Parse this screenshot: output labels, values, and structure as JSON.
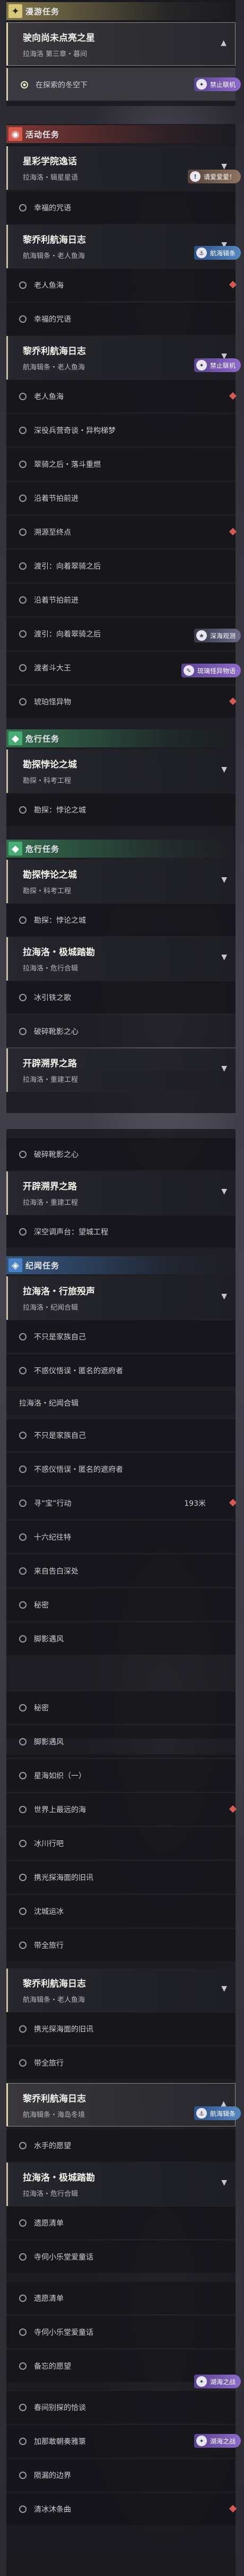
{
  "colors": {
    "main_accent": "#d8c77a",
    "event_accent": "#d85a4e",
    "daily_accent": "#47ad74",
    "discovery_accent": "#4a82c6",
    "marker_red": "#d25a52"
  },
  "sections": {
    "main": {
      "label": "漫游任务",
      "mark": "✦"
    },
    "event": {
      "label": "活动任务",
      "mark": "◉"
    },
    "daily1": {
      "label": "危行任务",
      "mark": "◆"
    },
    "daily2": {
      "label": "危行任务",
      "mark": "◆"
    },
    "discovery": {
      "label": "纪闻任务",
      "mark": "◈"
    }
  },
  "quests": [
    {
      "title": "驶向尚未点亮之星",
      "subtitle": "拉海洛 第三章・暮间"
    },
    {
      "title": "星彩学院逸话",
      "subtitle": "拉海洛・辑星星语"
    },
    {
      "title": "黎乔利航海日志",
      "subtitle": "航海辑条・老人鱼海"
    },
    {
      "title": "黎乔利航海日志",
      "subtitle": "航海辑条・老人鱼海"
    },
    {
      "title": "勘探悖论之城",
      "subtitle": "勘探・科考工程"
    },
    {
      "title": "勘探悖论之城",
      "subtitle": "勘探・科考工程"
    },
    {
      "title": "拉海洛・极城踏勘",
      "subtitle": "拉海洛・危行合辑"
    },
    {
      "title": "开辟溯界之路",
      "subtitle": "拉海洛・重建工程"
    },
    {
      "title": "开辟溯界之路",
      "subtitle": "拉海洛・重建工程"
    },
    {
      "title": "拉海洛・行旅殁声",
      "subtitle": "拉海洛・纪闻合辑"
    },
    {
      "title": "黎乔利航海日志",
      "subtitle": "航海辑条・老人鱼海"
    },
    {
      "title": "黎乔利航海日志",
      "subtitle": "航海辑条・海岛冬境"
    },
    {
      "title": "拉海洛・极城踏勘",
      "subtitle": "拉海洛・危行合辑"
    }
  ],
  "steps": [
    "在探索的冬空下",
    "幸福的咒语",
    "老人鱼海",
    "幸福的咒语",
    "老人鱼海",
    "深役兵营奇谈・异构梯梦",
    "翠骑之后・落斗重燃",
    "沿着节拍前进",
    "溯源至终点",
    "渡引：向着翠骑之后",
    "沿着节拍前进",
    "渡引：向着翠骑之后",
    "渡者斗大王",
    "琥珀怪异物",
    "勘探：悖论之城",
    "勘探：悖论之城",
    "冰引铁之歌",
    "破碎靴影之心",
    "破碎靴影之心",
    "深空调声台：望城工程",
    "不只是家族自己",
    "不惑仪悟误・匿名的遮府者",
    "不只是家族自己",
    "不惑仪悟误・匿名的遮府者",
    "寻“宝”行动",
    "十六纪往特",
    "来自告白深处",
    "秘密",
    "脚影遇风",
    "秘密",
    "脚影遇风",
    "星海如织（一）",
    "世界上最远的海",
    "冰川行吧",
    "携光探海面的旧讯",
    "沈城运冰",
    "带全旅行",
    "携光探海面的旧讯",
    "带全旅行",
    "水手的愿望",
    "遗愿清单",
    "寺伺小乐堂爱童话",
    "遗愿清单",
    "寺伺小乐堂爱童话",
    "备忘的愿望",
    "春间别探的恰谈",
    "加那敢朝奏雅箓",
    "陨漏的边界",
    "清冰沐条曲"
  ],
  "sub_labels": [
    "拉海洛・纪闻合辑"
  ],
  "step_count": "193米",
  "badges": {
    "no_combat": "禁止联机",
    "hint": "请爱爱爱！",
    "aquarium": "航海辑条",
    "boss": "深海观测",
    "tip": "琉璃怪异物语",
    "warm": "湖海之战"
  }
}
